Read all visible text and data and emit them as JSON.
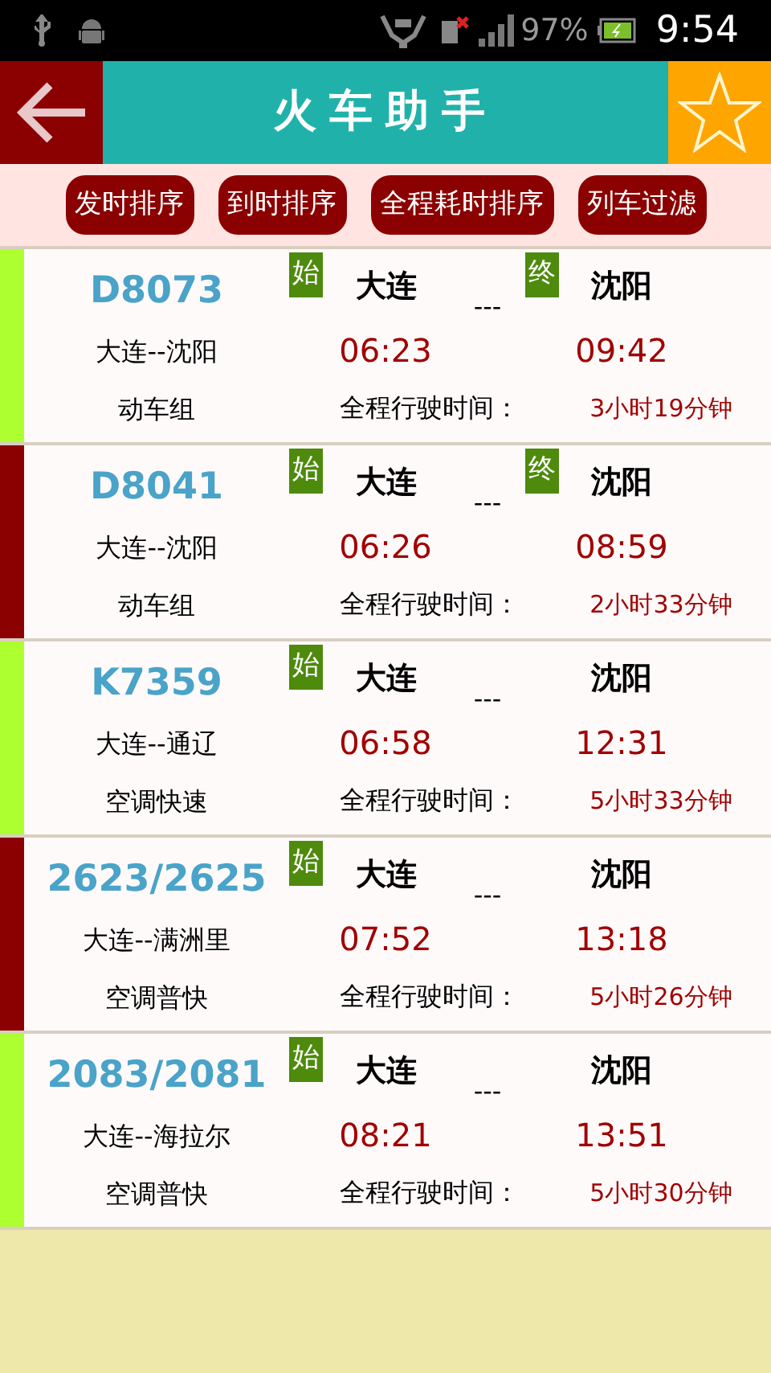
{
  "status_bar": {
    "battery": "97%",
    "time": "9:54"
  },
  "header": {
    "title": "火车助手"
  },
  "sort_buttons": [
    "发时排序",
    "到时排序",
    "全程耗时排序",
    "列车过滤"
  ],
  "trains": [
    {
      "number": "D8073",
      "route": "大连--沈阳",
      "type": "动车组",
      "start_badge": "始",
      "from": "大连",
      "separator": "---",
      "end_badge": "终",
      "to": "沈阳",
      "depart": "06:23",
      "arrive": "09:42",
      "duration_label": "全程行驶时间：",
      "duration": "3小时19分钟",
      "color": "#adff2f"
    },
    {
      "number": "D8041",
      "route": "大连--沈阳",
      "type": "动车组",
      "start_badge": "始",
      "from": "大连",
      "separator": "---",
      "end_badge": "终",
      "to": "沈阳",
      "depart": "06:26",
      "arrive": "08:59",
      "duration_label": "全程行驶时间：",
      "duration": "2小时33分钟",
      "color": "#8b0000"
    },
    {
      "number": "K7359",
      "route": "大连--通辽",
      "type": "空调快速",
      "start_badge": "始",
      "from": "大连",
      "separator": "---",
      "to": "沈阳",
      "depart": "06:58",
      "arrive": "12:31",
      "duration_label": "全程行驶时间：",
      "duration": "5小时33分钟",
      "color": "#adff2f"
    },
    {
      "number": "2623/2625",
      "route": "大连--满洲里",
      "type": "空调普快",
      "start_badge": "始",
      "from": "大连",
      "separator": "---",
      "to": "沈阳",
      "depart": "07:52",
      "arrive": "13:18",
      "duration_label": "全程行驶时间：",
      "duration": "5小时26分钟",
      "color": "#8b0000"
    },
    {
      "number": "2083/2081",
      "route": "大连--海拉尔",
      "type": "空调普快",
      "start_badge": "始",
      "from": "大连",
      "separator": "---",
      "to": "沈阳",
      "depart": "08:21",
      "arrive": "13:51",
      "duration_label": "全程行驶时间：",
      "duration": "5小时30分钟",
      "color": "#adff2f"
    }
  ]
}
